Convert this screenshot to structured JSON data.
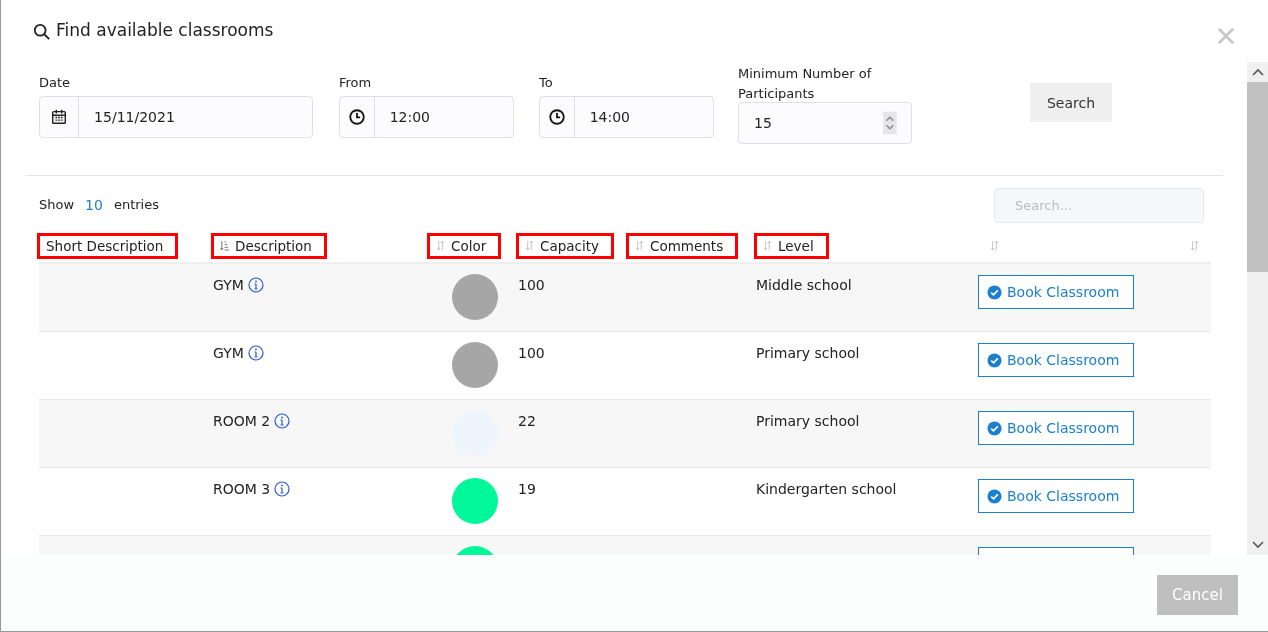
{
  "dialog": {
    "title": "Find available classrooms"
  },
  "filters": [
    {
      "kind": "date",
      "label": "Date",
      "value": "15/11/2021"
    },
    {
      "kind": "time",
      "label": "From",
      "value": "12:00"
    },
    {
      "kind": "time",
      "label": "To",
      "value": "14:00"
    },
    {
      "kind": "number",
      "label": "Minimum Number of Participants",
      "value": "15"
    }
  ],
  "search_button": "Search",
  "length": {
    "before": "Show",
    "value": "10",
    "after": "entries"
  },
  "table_search": {
    "placeholder": "Search..."
  },
  "table": {
    "columns": [
      {
        "label": "Short Description",
        "kind": "plain",
        "highlighted": true
      },
      {
        "label": "Description",
        "kind": "sorted",
        "highlighted": true
      },
      {
        "label": "Color",
        "kind": "sortable",
        "highlighted": true
      },
      {
        "label": "Capacity",
        "kind": "sortable",
        "highlighted": true
      },
      {
        "label": "Comments",
        "kind": "sortable",
        "highlighted": true
      },
      {
        "label": "Level",
        "kind": "sortable",
        "highlighted": true
      },
      {
        "kind": "sortable",
        "highlighted": false
      },
      {
        "kind": "sortable",
        "highlighted": false
      }
    ],
    "rows": [
      {
        "description": "GYM",
        "color": "#a6a6a6",
        "capacity": "100",
        "level": "Middle school",
        "action": "Book Classroom"
      },
      {
        "description": "GYM",
        "color": "#a6a6a6",
        "capacity": "100",
        "level": "Primary school",
        "action": "Book Classroom"
      },
      {
        "description": "ROOM 2",
        "color": "#eef5fd",
        "capacity": "22",
        "level": "Primary school",
        "action": "Book Classroom"
      },
      {
        "description": "ROOM 3",
        "color": "#00f79a",
        "capacity": "19",
        "level": "Kindergarten school",
        "action": "Book Classroom"
      },
      {
        "color": "#00f79a"
      }
    ]
  },
  "footer": {
    "cancel": "Cancel"
  }
}
